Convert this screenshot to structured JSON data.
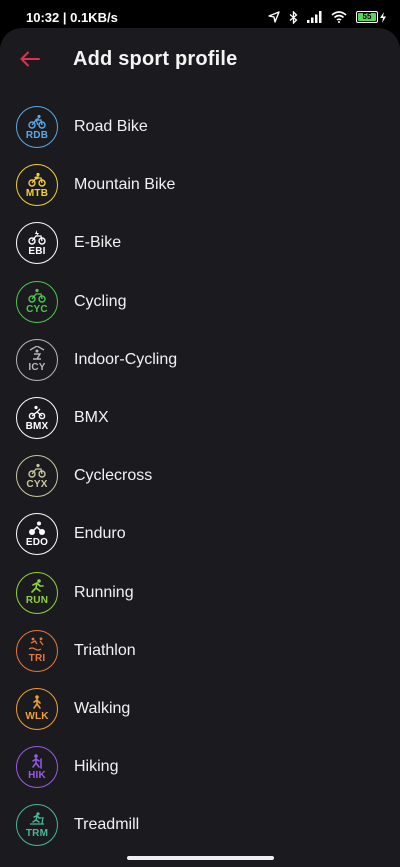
{
  "status_bar": {
    "time_speed": "10:32 | 0.1KB/s",
    "battery_level": "55"
  },
  "header": {
    "title": "Add sport profile",
    "back_icon": "arrow-left-icon",
    "accent_color": "#e03050"
  },
  "sports": [
    {
      "label": "Road Bike",
      "code": "RDB",
      "color": "#5aa9e6",
      "icon": "road-bike-icon"
    },
    {
      "label": "Mountain Bike",
      "code": "MTB",
      "color": "#f2d232",
      "icon": "mountain-bike-icon"
    },
    {
      "label": "E-Bike",
      "code": "EBI",
      "color": "#ffffff",
      "icon": "e-bike-icon"
    },
    {
      "label": "Cycling",
      "code": "CYC",
      "color": "#4cc84c",
      "icon": "cycling-icon"
    },
    {
      "label": "Indoor-Cycling",
      "code": "ICY",
      "color": "#b8b8b8",
      "icon": "indoor-cycling-icon"
    },
    {
      "label": "BMX",
      "code": "BMX",
      "color": "#ffffff",
      "icon": "bmx-icon"
    },
    {
      "label": "Cyclecross",
      "code": "CYX",
      "color": "#c8c8a0",
      "icon": "cyclecross-icon"
    },
    {
      "label": "Enduro",
      "code": "EDO",
      "color": "#ffffff",
      "icon": "enduro-icon"
    },
    {
      "label": "Running",
      "code": "RUN",
      "color": "#8fd43a",
      "icon": "running-icon"
    },
    {
      "label": "Triathlon",
      "code": "TRI",
      "color": "#e8773a",
      "icon": "triathlon-icon"
    },
    {
      "label": "Walking",
      "code": "WLK",
      "color": "#f0a030",
      "icon": "walking-icon"
    },
    {
      "label": "Hiking",
      "code": "HIK",
      "color": "#9a5ae8",
      "icon": "hiking-icon"
    },
    {
      "label": "Treadmill",
      "code": "TRM",
      "color": "#4ab89a",
      "icon": "treadmill-icon"
    }
  ]
}
